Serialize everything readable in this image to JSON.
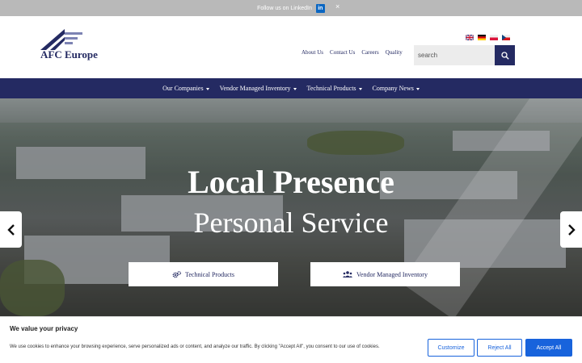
{
  "topbar": {
    "text": "Follow us on LinkedIn",
    "linkedin_icon": "linkedin-icon",
    "close": "×"
  },
  "header": {
    "logo_text": "AFC Europe",
    "flags": [
      "uk-flag",
      "german-flag",
      "polish-flag",
      "czech-flag"
    ],
    "nav": [
      "About Us",
      "Contact Us",
      "Careers",
      "Quality"
    ],
    "search_placeholder": "search",
    "search_icon": "search-icon"
  },
  "mainnav": {
    "items": [
      "Our Companies",
      "Vendor Managed Inventory",
      "Technical Products",
      "Company News"
    ]
  },
  "hero": {
    "headline1": "Local Presence",
    "headline2": "Personal Service",
    "cta1": "Technical Products",
    "cta2": "Vendor Managed Inventory"
  },
  "cookie": {
    "title": "We value your privacy",
    "text": "We use cookies to enhance your browsing experience, serve personalized ads or content, and analyze our traffic. By clicking \"Accept All\", you consent to our use of cookies.",
    "customize": "Customize",
    "reject": "Reject All",
    "accept": "Accept All"
  },
  "colors": {
    "brand_navy": "#242a62",
    "cookie_blue": "#1863dc"
  }
}
